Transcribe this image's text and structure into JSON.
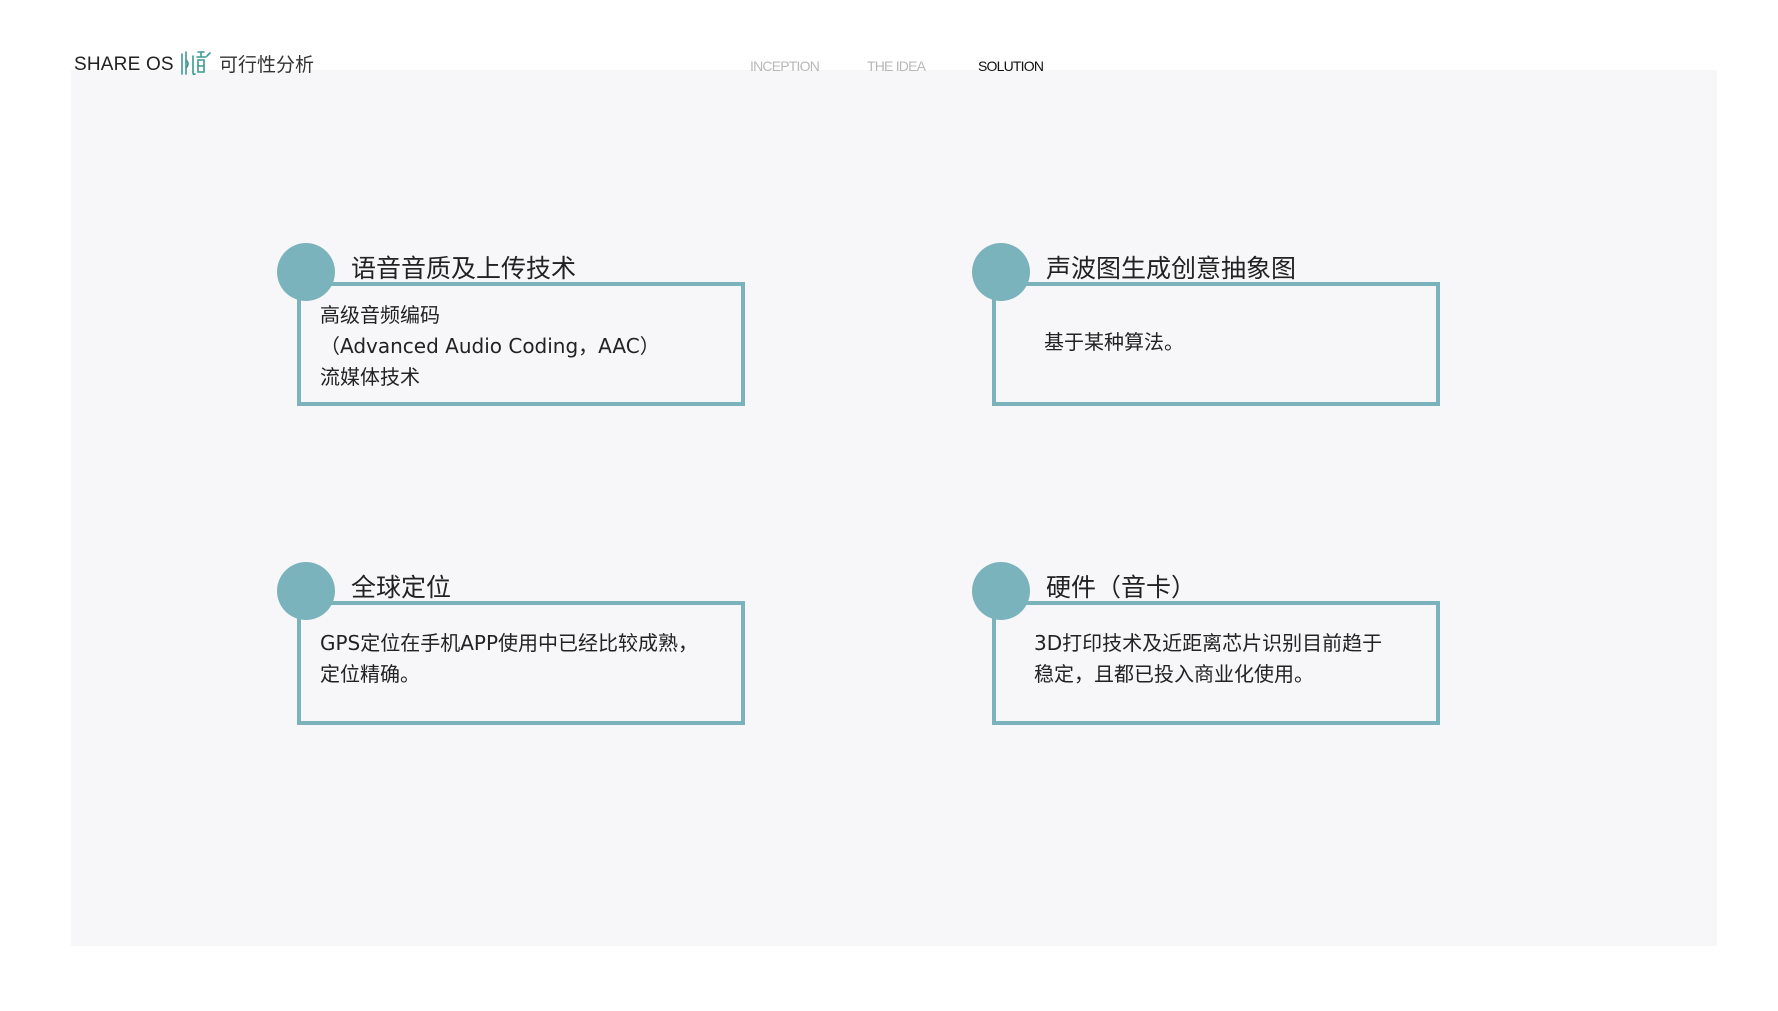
{
  "header": {
    "brand": "SHARE OS",
    "logo_icon": "sound-logo-icon",
    "title": "可行性分析"
  },
  "nav": {
    "items": [
      {
        "label": "INCEPTION",
        "active": false
      },
      {
        "label": "THE IDEA",
        "active": false
      },
      {
        "label": "SOLUTION",
        "active": true
      }
    ]
  },
  "colors": {
    "accent": "#7ab3bc",
    "panel": "#f7f7f9",
    "nav_inactive": "#b8b8b8"
  },
  "cards": [
    {
      "title": "语音音质及上传技术",
      "lines": [
        "高级音频编码",
        "（Advanced Audio Coding，AAC）",
        "流媒体技术"
      ]
    },
    {
      "title": "声波图生成创意抽象图",
      "lines": [
        "基于某种算法。"
      ]
    },
    {
      "title": "全球定位",
      "lines": [
        "GPS定位在手机APP使用中已经比较成熟，",
        "定位精确。"
      ]
    },
    {
      "title": "硬件（音卡）",
      "lines": [
        "3D打印技术及近距离芯片识别目前趋于",
        "稳定，且都已投入商业化使用。"
      ]
    }
  ]
}
